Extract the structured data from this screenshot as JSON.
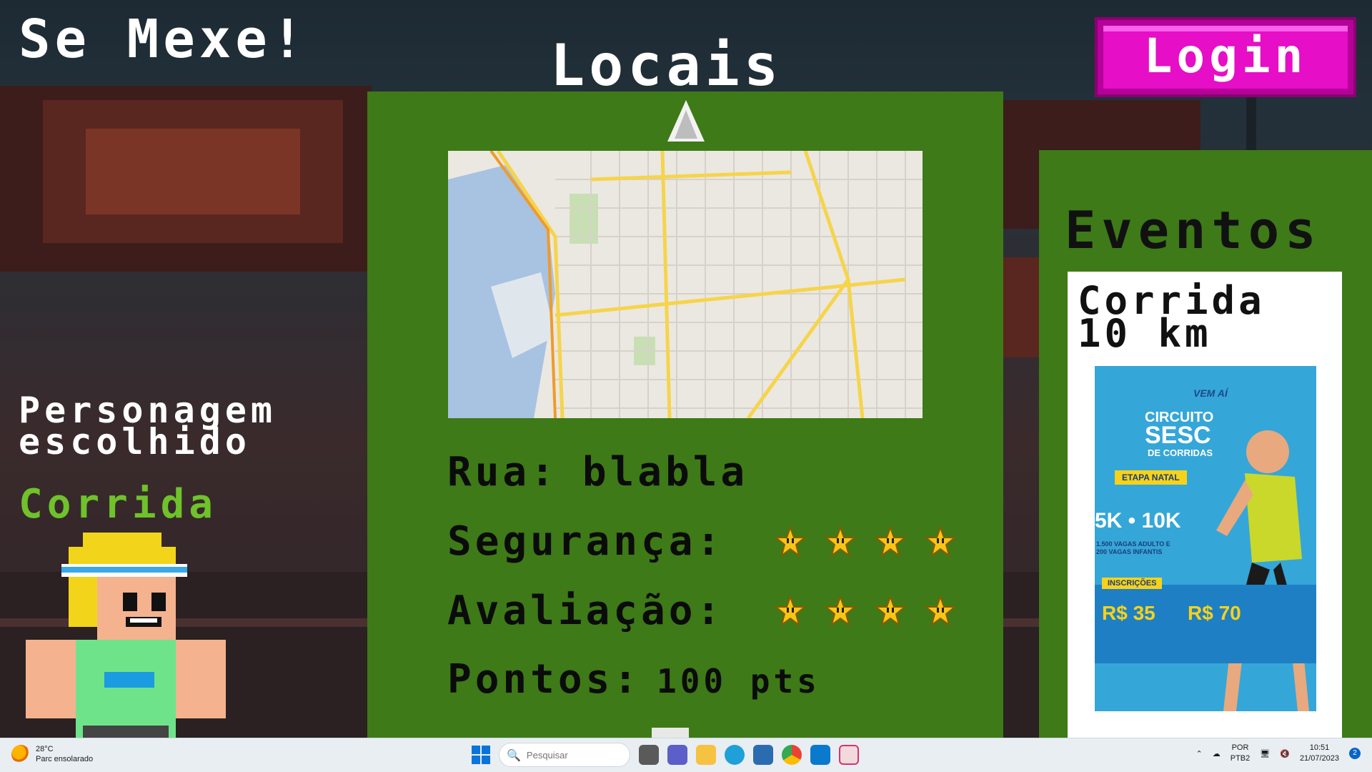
{
  "app": {
    "title": "Se Mexe!"
  },
  "header": {
    "login_label": "Login",
    "locais_title": "Locais"
  },
  "character": {
    "heading_line1": "Personagem",
    "heading_line2": "escolhido",
    "name": "Corrida"
  },
  "location": {
    "street_label": "Rua:",
    "street_value": "blabla",
    "safety_label": "Segurança:",
    "safety_stars": 4,
    "rating_label": "Avaliação:",
    "rating_stars": 4,
    "points_label": "Pontos:",
    "points_value": "100 pts"
  },
  "events": {
    "title": "Eventos",
    "card": {
      "name_line1": "Corrida",
      "name_line2": "10 km",
      "poster": {
        "vem": "VEM AÍ",
        "circuito": "CIRCUITO",
        "sesc": "SESC",
        "corridas": "DE CORRIDAS",
        "etapa": "ETAPA NATAL",
        "distances": "5K • 10K",
        "vagas": "1.500 VAGAS ADULTO E 200 VAGAS INFANTIS",
        "inscricoes": "INSCRIÇÕES",
        "price1": "R$ 35",
        "price2": "R$ 70"
      }
    }
  },
  "taskbar": {
    "temperature": "28°C",
    "weather": "Parc ensolarado",
    "search_placeholder": "Pesquisar",
    "lang1": "POR",
    "lang2": "PTB2",
    "time": "10:51",
    "date": "21/07/2023",
    "notifications": "2"
  },
  "colors": {
    "panel_green": "#3e7a17",
    "login_magenta": "#e60ec6",
    "char_green": "#6fc22b"
  }
}
